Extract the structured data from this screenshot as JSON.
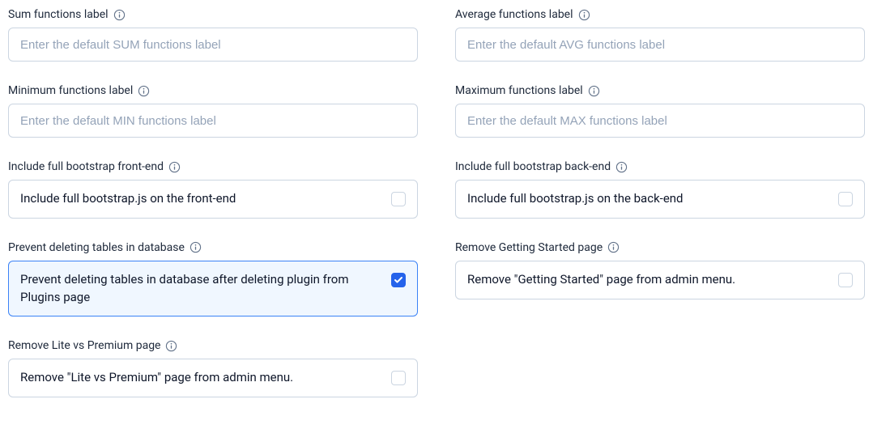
{
  "fields": {
    "sum": {
      "label": "Sum functions label",
      "placeholder": "Enter the default SUM functions label",
      "value": ""
    },
    "avg": {
      "label": "Average functions label",
      "placeholder": "Enter the default AVG functions label",
      "value": ""
    },
    "min": {
      "label": "Minimum functions label",
      "placeholder": "Enter the default MIN functions label",
      "value": ""
    },
    "max": {
      "label": "Maximum functions label",
      "placeholder": "Enter the default MAX functions label",
      "value": ""
    },
    "bootstrap_front": {
      "label": "Include full bootstrap front-end",
      "option": "Include full bootstrap.js on the front-end",
      "checked": false
    },
    "bootstrap_back": {
      "label": "Include full bootstrap back-end",
      "option": "Include full bootstrap.js on the back-end",
      "checked": false
    },
    "prevent_delete": {
      "label": "Prevent deleting tables in database",
      "option": "Prevent deleting tables in database after deleting plugin from Plugins page",
      "checked": true
    },
    "remove_getting_started": {
      "label": "Remove Getting Started page",
      "option": "Remove \"Getting Started\" page from admin menu.",
      "checked": false
    },
    "remove_lite_premium": {
      "label": "Remove Lite vs Premium page",
      "option": "Remove \"Lite vs Premium\" page from admin menu.",
      "checked": false
    }
  }
}
